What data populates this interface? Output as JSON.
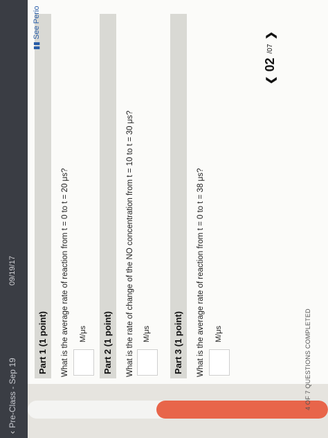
{
  "topbar": {
    "back_label": "Pre-Class - Sep 19",
    "timestamp": "09/19/17"
  },
  "progress": {
    "label": "4 OF 7 QUESTIONS COMPLETED",
    "completed": 4,
    "total": 7
  },
  "links": {
    "see_periodic": "See Perio"
  },
  "parts": [
    {
      "title": "Part 1   (1 point)",
      "question": "What is the average rate of reaction from t = 0 to t = 20 μs?",
      "unit": "M/μs"
    },
    {
      "title": "Part 2   (1 point)",
      "question": "What is the rate of change of the NO concentration from t = 10 to t = 30 μs?",
      "unit": "M/μs"
    },
    {
      "title": "Part 3   (1 point)",
      "question": "What is the average rate of reaction from t = 0 to t = 38 μs?",
      "unit": "M/μs"
    }
  ],
  "pager": {
    "current": "02",
    "of": "/07"
  }
}
